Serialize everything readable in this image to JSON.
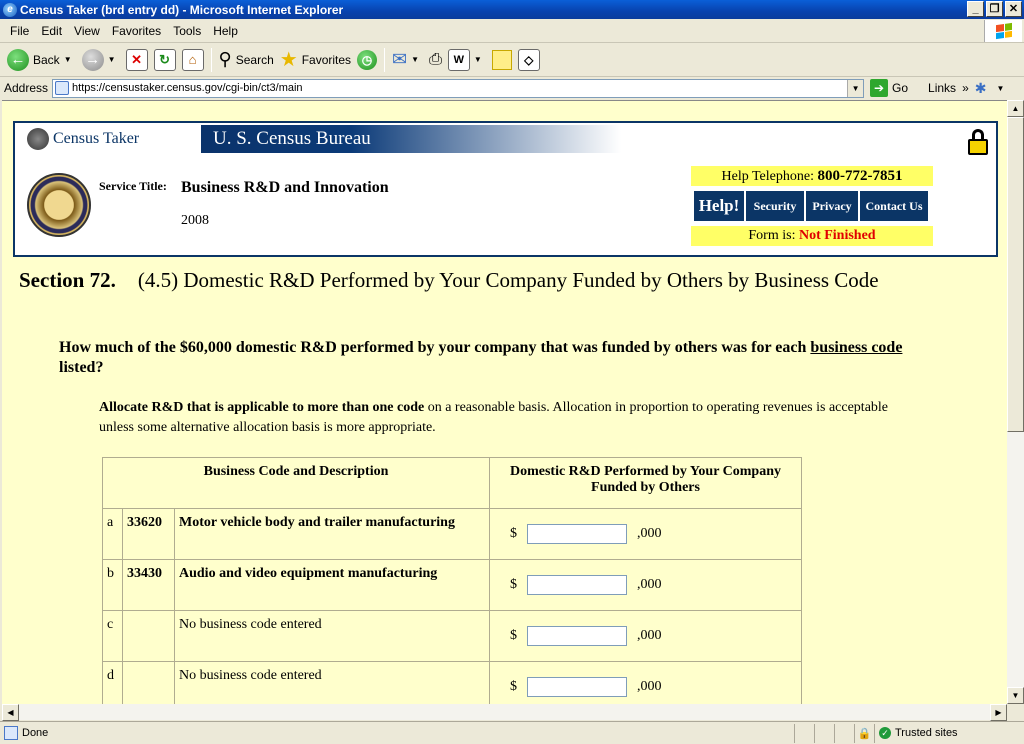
{
  "window": {
    "title": "Census Taker (brd entry dd) - Microsoft Internet Explorer"
  },
  "menu": [
    "File",
    "Edit",
    "View",
    "Favorites",
    "Tools",
    "Help"
  ],
  "toolbar": {
    "back": "Back",
    "search": "Search",
    "favorites": "Favorites"
  },
  "address": {
    "label": "Address",
    "url": "https://censustaker.census.gov/cgi-bin/ct3/main",
    "go": "Go",
    "links": "Links"
  },
  "header": {
    "census_taker": "Census Taker",
    "bureau": "U. S. Census Bureau",
    "service_label": "Service Title:",
    "service_title": "Business R&D and Innovation",
    "year": "2008",
    "help_tel_label": "Help Telephone:",
    "help_tel": "800-772-7851",
    "nav": [
      "Help!",
      "Security",
      "Privacy",
      "Contact Us"
    ],
    "form_status_label": "Form is:",
    "form_status": "Not Finished"
  },
  "section": {
    "number": "Section 72.",
    "title": "(4.5) Domestic R&D Performed by Your Company Funded by Others by Business Code",
    "question_pre": "How much of the $60,000 domestic R&D performed by your company that was funded by others was for each",
    "question_link": "business code",
    "question_post": "listed?",
    "instruction_bold": "Allocate R&D that is applicable to more than one code",
    "instruction_rest": "on a reasonable basis. Allocation in proportion to operating revenues is acceptable unless some alternative allocation basis is more appropriate."
  },
  "table": {
    "col1": "Business Code and Description",
    "col2": "Domestic R&D Performed by Your Company Funded by Others",
    "currency": "$",
    "suffix": ",000",
    "rows": [
      {
        "letter": "a",
        "code": "33620",
        "desc": "Motor vehicle body and trailer manufacturing",
        "value": ""
      },
      {
        "letter": "b",
        "code": "33430",
        "desc": "Audio and video equipment manufacturing",
        "value": ""
      },
      {
        "letter": "c",
        "code": "",
        "desc": "No business code entered",
        "value": ""
      },
      {
        "letter": "d",
        "code": "",
        "desc": "No business code entered",
        "value": ""
      }
    ]
  },
  "status": {
    "left": "Done",
    "zone": "Trusted sites"
  }
}
